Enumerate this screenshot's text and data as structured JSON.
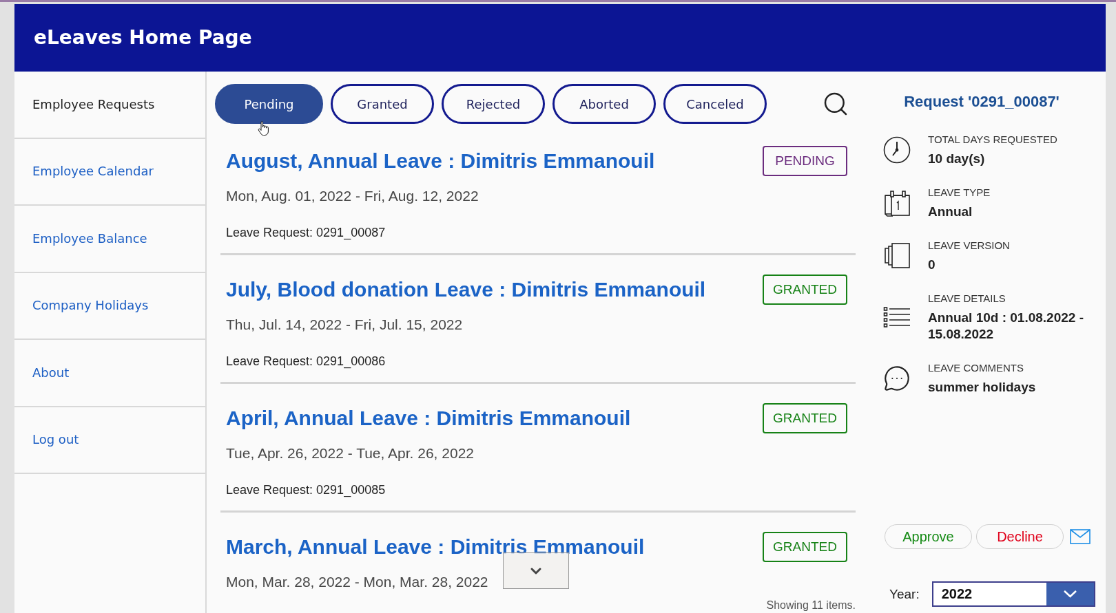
{
  "header": {
    "title": "eLeaves Home Page"
  },
  "sidebar": {
    "items": [
      {
        "label": "Employee Requests",
        "selected": true
      },
      {
        "label": "Employee Calendar",
        "selected": false
      },
      {
        "label": "Employee Balance",
        "selected": false
      },
      {
        "label": "Company Holidays",
        "selected": false
      },
      {
        "label": "About",
        "selected": false
      },
      {
        "label": "Log out",
        "selected": false
      }
    ]
  },
  "filter_tabs": [
    {
      "label": "Pending",
      "selected": true
    },
    {
      "label": "Granted",
      "selected": false
    },
    {
      "label": "Rejected",
      "selected": false
    },
    {
      "label": "Aborted",
      "selected": false
    },
    {
      "label": "Canceled",
      "selected": false
    }
  ],
  "requests": [
    {
      "title": "August, Annual Leave : Dimitris Emmanouil",
      "dates": "Mon, Aug. 01, 2022 - Fri, Aug. 12, 2022",
      "request_number": "Leave Request: 0291_00087",
      "status": {
        "text": "PENDING",
        "color": "#6b2c7e"
      }
    },
    {
      "title": "July, Blood donation Leave : Dimitris Emmanouil",
      "dates": "Thu, Jul. 14, 2022 - Fri, Jul. 15, 2022",
      "request_number": "Leave Request: 0291_00086",
      "status": {
        "text": "GRANTED",
        "color": "#168216"
      }
    },
    {
      "title": "April, Annual Leave : Dimitris Emmanouil",
      "dates": "Tue, Apr. 26, 2022 - Tue, Apr. 26, 2022",
      "request_number": "Leave Request: 0291_00085",
      "status": {
        "text": "GRANTED",
        "color": "#168216"
      }
    },
    {
      "title": "March, Annual Leave : Dimitris Emmanouil",
      "dates": "Mon, Mar. 28, 2022 - Mon, Mar. 28, 2022",
      "status": {
        "text": "GRANTED",
        "color": "#168216"
      }
    }
  ],
  "list_footer": {
    "count": "Showing 11 items."
  },
  "details": {
    "title": "Request '0291_00087'",
    "fields": [
      {
        "kind": "duration",
        "label": "TOTAL DAYS REQUESTED",
        "value": "10 day(s)"
      },
      {
        "kind": "type",
        "label": "LEAVE TYPE",
        "value": "Annual"
      },
      {
        "kind": "version",
        "label": "LEAVE VERSION",
        "value": "0"
      },
      {
        "kind": "details",
        "label": "LEAVE DETAILS",
        "value": "Annual 10d : 01.08.2022 - 15.08.2022"
      },
      {
        "kind": "comments",
        "label": "LEAVE COMMENTS",
        "value": "summer holidays"
      }
    ],
    "actions": [
      {
        "label": "Approve",
        "color": "#148a14"
      },
      {
        "label": "Decline",
        "color": "#e0001a"
      }
    ],
    "year": {
      "label": "Year:",
      "value": "2022"
    }
  }
}
